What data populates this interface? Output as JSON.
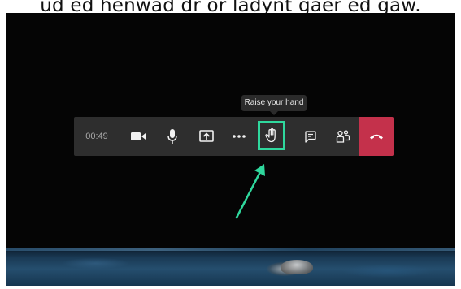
{
  "caption": {
    "text": "ud ed henwad dr or ladynt gaer ed gaw."
  },
  "tooltip": {
    "text": "Raise your hand"
  },
  "toolbar": {
    "timer": "00:49",
    "buttons": [
      {
        "icon": "video-camera-icon"
      },
      {
        "icon": "microphone-icon"
      },
      {
        "icon": "share-screen-icon"
      },
      {
        "icon": "more-options-icon"
      },
      {
        "icon": "raise-hand-icon",
        "highlighted": true
      },
      {
        "icon": "chat-icon"
      },
      {
        "icon": "participants-icon"
      },
      {
        "icon": "hang-up-icon"
      }
    ]
  },
  "colors": {
    "toolbar_bg": "#2e2e2e",
    "highlight": "#2fd89d",
    "hangup": "#c4314b",
    "arrow": "#2fd89d"
  }
}
